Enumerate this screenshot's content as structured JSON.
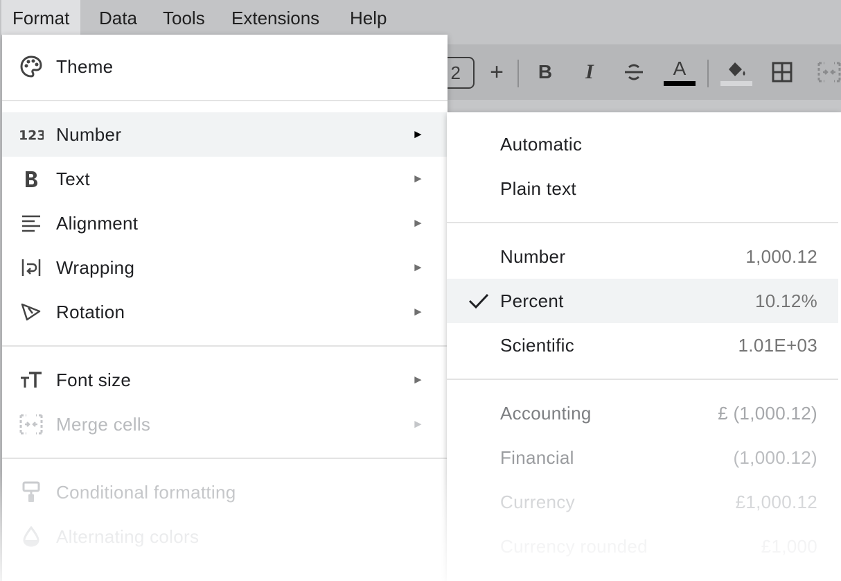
{
  "menubar": {
    "items": [
      {
        "label": "Format",
        "active": true
      },
      {
        "label": "Data"
      },
      {
        "label": "Tools"
      },
      {
        "label": "Extensions"
      },
      {
        "label": "Help"
      }
    ]
  },
  "toolbar": {
    "font_size_value": "2",
    "increase_font_glyph": "+",
    "bold_glyph": "B",
    "italic_glyph": "I",
    "text_color_glyph": "A"
  },
  "format_menu": {
    "items": [
      {
        "label": "Theme",
        "icon": "palette-icon"
      },
      {
        "label": "Number",
        "icon": "number-123-icon",
        "submenu": true,
        "highlighted": true
      },
      {
        "label": "Text",
        "icon": "bold-icon",
        "submenu": true
      },
      {
        "label": "Alignment",
        "icon": "align-left-icon",
        "submenu": true
      },
      {
        "label": "Wrapping",
        "icon": "wrap-icon",
        "submenu": true
      },
      {
        "label": "Rotation",
        "icon": "rotation-icon",
        "submenu": true
      },
      {
        "label": "Font size",
        "icon": "font-size-icon",
        "submenu": true
      },
      {
        "label": "Merge cells",
        "icon": "merge-cells-icon",
        "submenu": true,
        "disabled": true
      },
      {
        "label": "Conditional formatting",
        "icon": "paint-roller-icon",
        "disabled": true
      },
      {
        "label": "Alternating colors",
        "icon": "drop-icon",
        "disabled": true
      }
    ],
    "submenu_arrow": "►"
  },
  "number_submenu": {
    "items": [
      {
        "label": "Automatic",
        "value": ""
      },
      {
        "label": "Plain text",
        "value": ""
      },
      {
        "label": "Number",
        "value": "1,000.12"
      },
      {
        "label": "Percent",
        "value": "10.12%",
        "checked": true
      },
      {
        "label": "Scientific",
        "value": "1.01E+03"
      },
      {
        "label": "Accounting",
        "value": "£ (1,000.12)"
      },
      {
        "label": "Financial",
        "value": "(1,000.12)"
      },
      {
        "label": "Currency",
        "value": "£1,000.12"
      },
      {
        "label": "Currency rounded",
        "value": "£1,000"
      }
    ]
  },
  "colors": {
    "menubar_bg": "#c3c4c6",
    "menu_bg": "#ffffff",
    "hover_bg": "#f1f3f4",
    "text": "#202124",
    "disabled_text": "#b9bbbe"
  }
}
